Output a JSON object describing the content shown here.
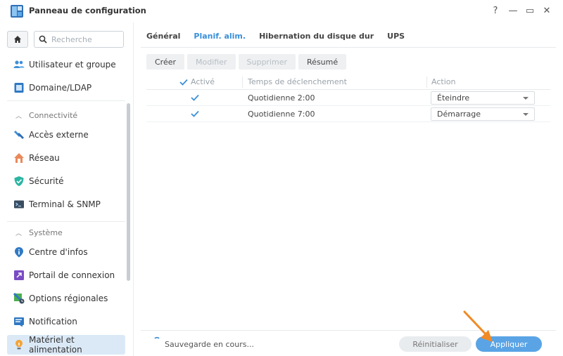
{
  "window": {
    "title": "Panneau de configuration",
    "controls": [
      "?",
      "—",
      "▭",
      "✕"
    ]
  },
  "sidebar": {
    "search_placeholder": "Recherche",
    "items_top": [
      {
        "label": "Utilisateur et groupe",
        "icon": "users-icon"
      },
      {
        "label": "Domaine/LDAP",
        "icon": "domain-icon"
      }
    ],
    "sections": [
      {
        "title": "Connectivité",
        "items": [
          {
            "label": "Accès externe",
            "icon": "external-access-icon"
          },
          {
            "label": "Réseau",
            "icon": "network-house-icon"
          },
          {
            "label": "Sécurité",
            "icon": "shield-icon"
          },
          {
            "label": "Terminal & SNMP",
            "icon": "terminal-icon"
          }
        ]
      },
      {
        "title": "Système",
        "items": [
          {
            "label": "Centre d'infos",
            "icon": "info-icon"
          },
          {
            "label": "Portail de connexion",
            "icon": "portal-icon"
          },
          {
            "label": "Options régionales",
            "icon": "regional-icon"
          },
          {
            "label": "Notification",
            "icon": "notification-icon"
          },
          {
            "label": "Matériel et alimentation",
            "icon": "bulb-icon",
            "active": true
          }
        ]
      }
    ]
  },
  "tabs": [
    {
      "label": "Général",
      "active": false
    },
    {
      "label": "Planif. alim.",
      "active": true
    },
    {
      "label": "Hibernation du disque dur",
      "active": false
    },
    {
      "label": "UPS",
      "active": false
    }
  ],
  "toolbar": {
    "create": "Créer",
    "edit": "Modifier",
    "delete": "Supprimer",
    "summary": "Résumé"
  },
  "grid": {
    "headers": {
      "enabled": "Activé",
      "trigger": "Temps de déclenchement",
      "action": "Action"
    },
    "rows": [
      {
        "enabled": true,
        "trigger": "Quotidienne 2:00",
        "action": "Éteindre"
      },
      {
        "enabled": true,
        "trigger": "Quotidienne 7:00",
        "action": "Démarrage"
      }
    ]
  },
  "footer": {
    "status": "Sauvegarde en cours...",
    "reset": "Réinitialiser",
    "apply": "Appliquer"
  },
  "colors": {
    "accent": "#3a8fd9",
    "apply_button": "#5aa4e6",
    "annotation_arrow": "#f08a24"
  }
}
